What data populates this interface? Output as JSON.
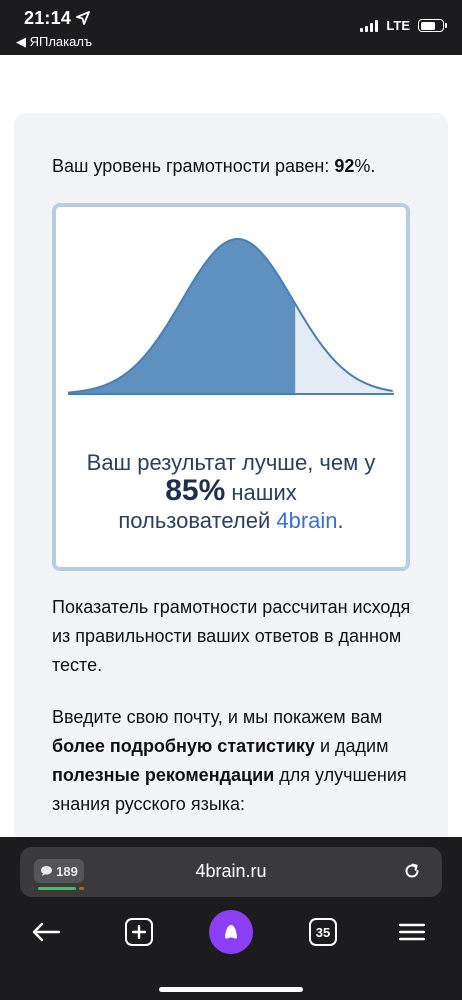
{
  "status_bar": {
    "time": "21:14",
    "back_app": "◀ ЯПлакалъ",
    "network": "LTE"
  },
  "content": {
    "score_prefix": "Ваш уровень грамотности равен: ",
    "score_value": "92",
    "score_suffix": "%.",
    "result_line1": "Ваш результат лучше, чем у",
    "result_percent": "85%",
    "result_line2_suffix": " наших",
    "result_line3_prefix": "пользователей ",
    "result_brand": "4brain",
    "result_line3_suffix": ".",
    "para1": "Показатель грамотности рассчитан исходя из правильности ваших ответов в данном тесте.",
    "para2_part1": "Введите свою почту, и мы покажем вам ",
    "para2_bold1": "более подробную статистику",
    "para2_part2": " и дадим ",
    "para2_bold2": "полезные рекомендации",
    "para2_part3": " для улучшения знания русского языка:",
    "curve_percentile": 0.85,
    "curve_fill_color": "#5e90c0",
    "curve_rest_color": "#e3ebf4"
  },
  "browser": {
    "comments_count": "189",
    "url": "4brain.ru",
    "tabs_count": "35"
  }
}
